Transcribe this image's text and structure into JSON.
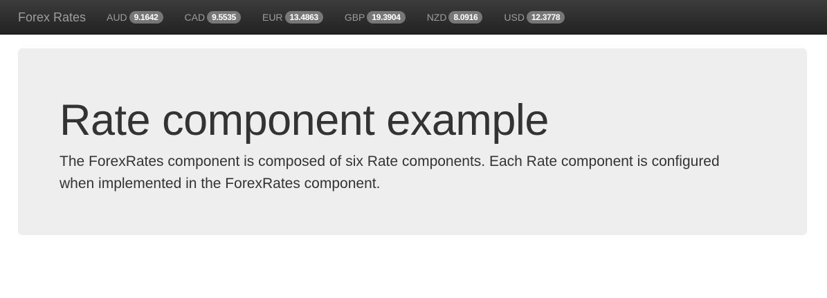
{
  "navbar": {
    "brand": "Forex Rates",
    "rates": [
      {
        "code": "AUD",
        "value": "9.1642"
      },
      {
        "code": "CAD",
        "value": "9.5535"
      },
      {
        "code": "EUR",
        "value": "13.4863"
      },
      {
        "code": "GBP",
        "value": "19.3904"
      },
      {
        "code": "NZD",
        "value": "8.0916"
      },
      {
        "code": "USD",
        "value": "12.3778"
      }
    ]
  },
  "jumbotron": {
    "title": "Rate component example",
    "description": "The ForexRates component is composed of six Rate components. Each Rate component is configured when implemented in the ForexRates component."
  },
  "colors": {
    "navbar_bg": "#222222",
    "nav_text": "#9d9d9d",
    "badge_bg": "#777777",
    "badge_text": "#ffffff",
    "jumbotron_bg": "#eeeeee",
    "text": "#333333"
  }
}
